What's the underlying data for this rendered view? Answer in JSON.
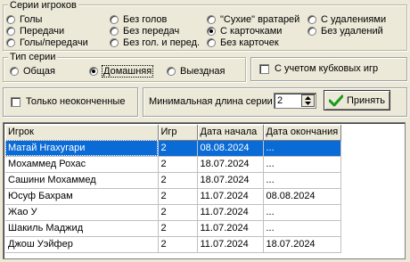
{
  "series_group": {
    "title": "Серии игроков",
    "options": [
      {
        "label": "Голы",
        "selected": false
      },
      {
        "label": "Без голов",
        "selected": false
      },
      {
        "label": "\"Сухие\" вратарей",
        "selected": false
      },
      {
        "label": "С удалениями",
        "selected": false
      },
      {
        "label": "Передачи",
        "selected": false
      },
      {
        "label": "Без передач",
        "selected": false
      },
      {
        "label": "С карточками",
        "selected": true
      },
      {
        "label": "Без удалений",
        "selected": false
      },
      {
        "label": "Голы/передачи",
        "selected": false
      },
      {
        "label": "Без гол. и перед.",
        "selected": false
      },
      {
        "label": "Без карточек",
        "selected": false
      }
    ]
  },
  "type_group": {
    "title": "Тип серии",
    "options": [
      {
        "label": "Общая",
        "selected": false
      },
      {
        "label": "Домашняя",
        "selected": true
      },
      {
        "label": "Выездная",
        "selected": false
      }
    ]
  },
  "cup_games": {
    "label": "С учетом кубковых игр",
    "checked": false
  },
  "unfinished_only": {
    "label": "Только неоконченные",
    "checked": false
  },
  "min_length": {
    "label": "Минимальная длина серии",
    "value": "2"
  },
  "apply_button": {
    "label": "Принять"
  },
  "table": {
    "columns": [
      "Игрок",
      "Игр",
      "Дата начала",
      "Дата окончания"
    ],
    "rows": [
      {
        "player": "Матай Нгахугари",
        "games": "2",
        "start": "08.08.2024",
        "end": "...",
        "selected": true
      },
      {
        "player": "Мохаммед Рохас",
        "games": "2",
        "start": "18.07.2024",
        "end": "..."
      },
      {
        "player": "Сашини Мохаммед",
        "games": "2",
        "start": "18.07.2024",
        "end": "..."
      },
      {
        "player": "Юсуф Бахрам",
        "games": "2",
        "start": "11.07.2024",
        "end": "08.08.2024"
      },
      {
        "player": "Жао У",
        "games": "2",
        "start": "11.07.2024",
        "end": "..."
      },
      {
        "player": "Шакиль Маджид",
        "games": "2",
        "start": "11.07.2024",
        "end": "..."
      },
      {
        "player": "Джош Уэйфер",
        "games": "2",
        "start": "11.07.2024",
        "end": "18.07.2024"
      }
    ]
  },
  "colors": {
    "selection": "#0a6bd6",
    "window_bg": "#ece9d8",
    "apply_check": "#1a9a1a"
  }
}
